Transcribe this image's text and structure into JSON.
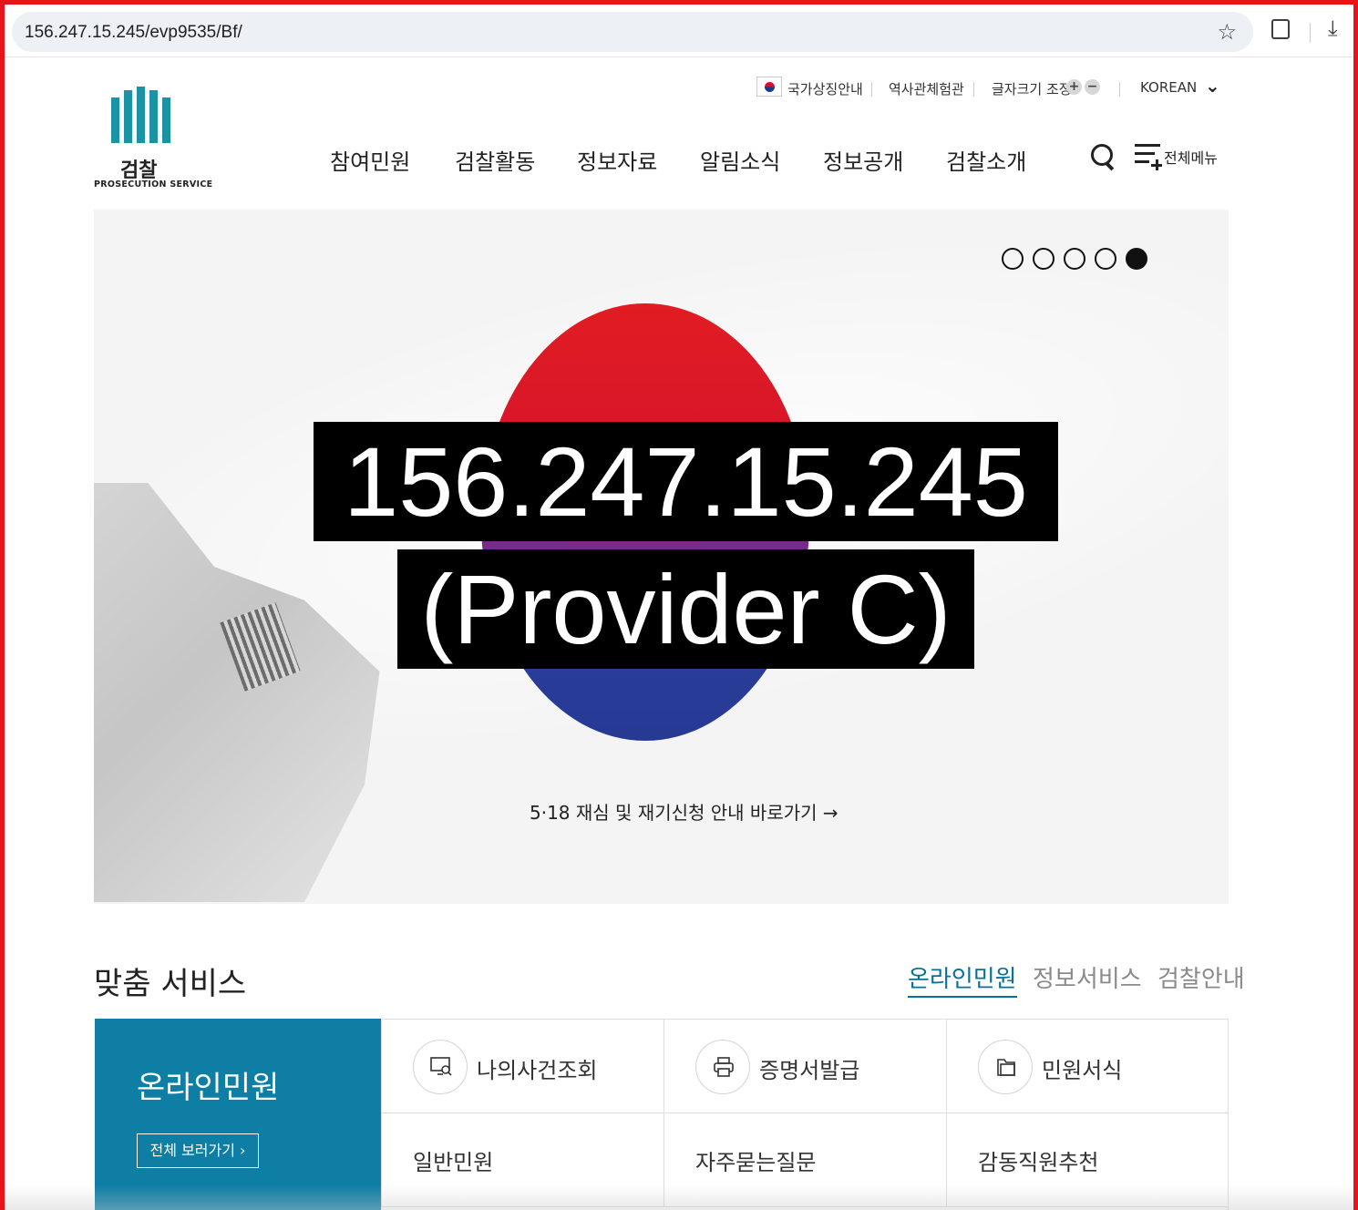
{
  "browser": {
    "url": "156.247.15.245/evp9535/Bf/",
    "icons": [
      "star-icon",
      "extension-icon",
      "download-icon"
    ]
  },
  "site": {
    "logo_kr": "검찰",
    "logo_en": "PROSECUTION SERVICE",
    "logo_color": "#1a93a5"
  },
  "util_bar": {
    "national_symbol": "국가상징안내",
    "history_hall": "역사관체험관",
    "font_size": "글자크기 조정",
    "font_plus": "+",
    "font_minus": "−",
    "language": "KOREAN"
  },
  "gnb": {
    "items": [
      "참여민원",
      "검찰활동",
      "정보자료",
      "알림소식",
      "정보공개",
      "검찰소개"
    ],
    "all_menu": "전체메뉴"
  },
  "hero": {
    "slide_count": 5,
    "active_slide": 5,
    "link_text": "5·18 재심 및 재기신청 안내 바로가기 →"
  },
  "overlay": {
    "line1": "156.247.15.245",
    "line2": "(Provider C)"
  },
  "service": {
    "title": "맞춤 서비스",
    "tabs": [
      "온라인민원",
      "정보서비스",
      "검찰안내"
    ],
    "active_tab": "온라인민원",
    "panel_title": "온라인민원",
    "panel_button": "전체 보러가기  ›",
    "accent": "#0e7ea5",
    "cells": [
      {
        "label": "나의사건조회",
        "icon": "monitor-search-icon"
      },
      {
        "label": "증명서발급",
        "icon": "printer-icon"
      },
      {
        "label": "민원서식",
        "icon": "folder-icon"
      },
      {
        "label": "일반민원"
      },
      {
        "label": "자주묻는질문"
      },
      {
        "label": "감동직원추천"
      }
    ]
  }
}
